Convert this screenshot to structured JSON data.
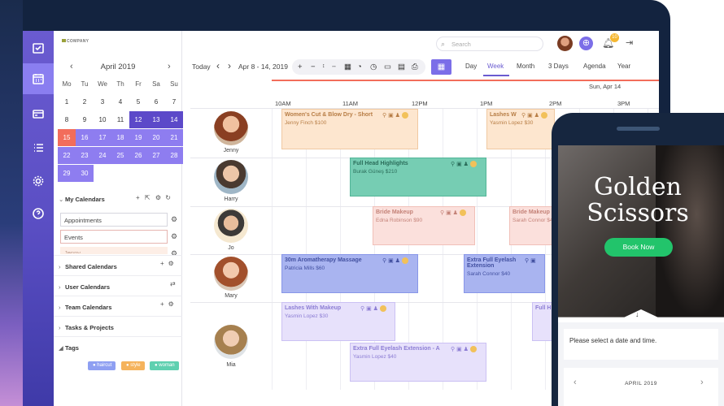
{
  "app": {
    "logo_text": "COMPANY"
  },
  "header": {
    "search_placeholder": "Search",
    "notification_count": "10"
  },
  "mini_calendar": {
    "title": "April 2019",
    "prev": "‹",
    "next": "›",
    "weekdays": [
      "Mo",
      "Tu",
      "We",
      "Th",
      "Fr",
      "Sa",
      "Su"
    ],
    "weeks": [
      [
        "1",
        "2",
        "3",
        "4",
        "5",
        "6",
        "7"
      ],
      [
        "8",
        "9",
        "10",
        "11",
        "12",
        "13",
        "14"
      ],
      [
        "15",
        "16",
        "17",
        "18",
        "19",
        "20",
        "21"
      ],
      [
        "22",
        "23",
        "24",
        "25",
        "26",
        "27",
        "28"
      ],
      [
        "29",
        "30"
      ]
    ]
  },
  "sidebar": {
    "my_calendars": "My Calendars",
    "calendar_inputs": [
      "Appointments",
      "Events",
      "Jenny"
    ],
    "sections": [
      "Shared Calendars",
      "User Calendars",
      "Team Calendars",
      "Tasks & Projects",
      "Tags"
    ],
    "tags": [
      {
        "label": "haircut",
        "color": "#8e9ff2"
      },
      {
        "label": "style",
        "color": "#f5b35c"
      },
      {
        "label": "woman",
        "color": "#5fd0b0"
      }
    ]
  },
  "toolbar": {
    "today": "Today",
    "prev": "‹",
    "next": "›",
    "range": "Apr 8 - 14, 2019",
    "views": [
      "Day",
      "Week",
      "Month",
      "3 Days",
      "Agenda",
      "Year"
    ],
    "selected_view": "Week"
  },
  "schedule": {
    "date_label": "Sun, Apr 14",
    "times": [
      "10AM",
      "11AM",
      "12PM",
      "1PM",
      "2PM",
      "3PM"
    ],
    "people": [
      "Jenny",
      "Harry",
      "Jo",
      "Mary",
      "Mia"
    ],
    "events": [
      {
        "title": "Women's Cut & Blow Dry - Short",
        "sub": "Jenny Finch $100",
        "bg": "#fde6cf",
        "border": "#f0c9a2",
        "text": "#b77d45"
      },
      {
        "title": "Lashes W",
        "sub": "Yasmin Lopez $30",
        "bg": "#fde6cf",
        "border": "#f0c9a2",
        "text": "#b77d45"
      },
      {
        "title": "Full Head Highlights",
        "sub": "Burak Güneş $210",
        "bg": "#76cdb3",
        "border": "#52b597",
        "text": "#2b6d5a"
      },
      {
        "title": "Bride Makeup",
        "sub": "Edna Robinson $90",
        "bg": "#fbe0dc",
        "border": "#f1c0b8",
        "text": "#c48278"
      },
      {
        "title": "Bride Makeup",
        "sub": "Sarah Connor $40",
        "bg": "#fbe0dc",
        "border": "#f1c0b8",
        "text": "#c48278"
      },
      {
        "title": "30m Aromatherapy Massage",
        "sub": "Patricia Mills $60",
        "bg": "#a9b4f0",
        "border": "#8796e8",
        "text": "#4250a0"
      },
      {
        "title": "Extra Full Eyelash Extension",
        "sub": "Sarah Connor $40",
        "bg": "#a9b4f0",
        "border": "#8796e8",
        "text": "#4250a0"
      },
      {
        "title": "Lashes With Makeup",
        "sub": "Yasmin Lopez $30",
        "bg": "#e7e1fb",
        "border": "#cbc1f3",
        "text": "#8c7dd4"
      },
      {
        "title": "Full H",
        "sub": "",
        "bg": "#e7e1fb",
        "border": "#cbc1f3",
        "text": "#8c7dd4"
      },
      {
        "title": "Extra Full Eyelash Extension - A",
        "sub": "Yasmin Lopez $40",
        "bg": "#e7e1fb",
        "border": "#cbc1f3",
        "text": "#8c7dd4"
      }
    ]
  },
  "phone": {
    "hero_title_line1": "Golden",
    "hero_title_line2": "Scissors",
    "book_button": "Book Now",
    "prompt": "Please select a date and time.",
    "month_label": "APRIL 2019"
  },
  "colors": {
    "accent": "#6a5bd0",
    "today": "#f26d5b",
    "range": "#8e7df0",
    "book": "#22c46b"
  }
}
